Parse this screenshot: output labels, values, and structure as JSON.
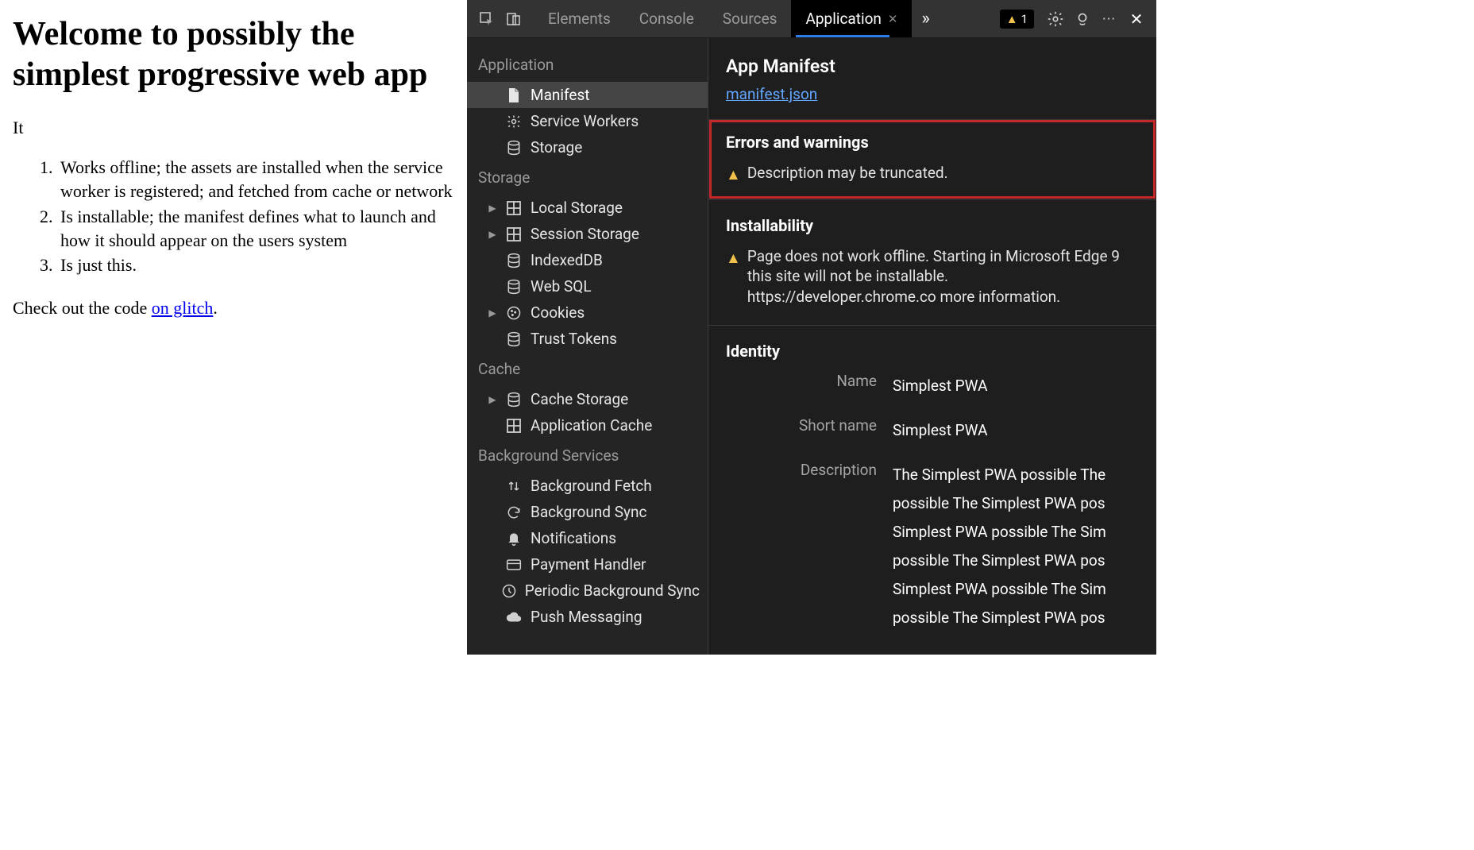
{
  "page": {
    "heading": "Welcome to possibly the simplest progressive web app",
    "intro": "It",
    "list": [
      "Works offline; the assets are installed when the service worker is registered; and fetched from cache or network",
      "Is installable; the manifest defines what to launch and how it should appear on the users system",
      "Is just this."
    ],
    "footer_prefix": "Check out the code ",
    "footer_link": "on glitch",
    "footer_suffix": "."
  },
  "devtools": {
    "tabs": [
      "Elements",
      "Console",
      "Sources",
      "Application"
    ],
    "active_tab": "Application",
    "warning_count": "1",
    "sidebar": {
      "groups": [
        {
          "title": "Application",
          "items": [
            {
              "icon": "file",
              "label": "Manifest",
              "selected": true
            },
            {
              "icon": "gear",
              "label": "Service Workers"
            },
            {
              "icon": "db",
              "label": "Storage"
            }
          ]
        },
        {
          "title": "Storage",
          "items": [
            {
              "icon": "grid",
              "label": "Local Storage",
              "expandable": true
            },
            {
              "icon": "grid",
              "label": "Session Storage",
              "expandable": true
            },
            {
              "icon": "db",
              "label": "IndexedDB"
            },
            {
              "icon": "db",
              "label": "Web SQL"
            },
            {
              "icon": "cookie",
              "label": "Cookies",
              "expandable": true
            },
            {
              "icon": "db",
              "label": "Trust Tokens"
            }
          ]
        },
        {
          "title": "Cache",
          "items": [
            {
              "icon": "db",
              "label": "Cache Storage",
              "expandable": true
            },
            {
              "icon": "grid",
              "label": "Application Cache"
            }
          ]
        },
        {
          "title": "Background Services",
          "items": [
            {
              "icon": "updown",
              "label": "Background Fetch"
            },
            {
              "icon": "sync",
              "label": "Background Sync"
            },
            {
              "icon": "bell",
              "label": "Notifications"
            },
            {
              "icon": "card",
              "label": "Payment Handler"
            },
            {
              "icon": "clock",
              "label": "Periodic Background Sync"
            },
            {
              "icon": "cloud",
              "label": "Push Messaging"
            }
          ]
        }
      ]
    },
    "detail": {
      "title": "App Manifest",
      "manifest_link": "manifest.json",
      "errors_heading": "Errors and warnings",
      "errors_warning": "Description may be truncated.",
      "installability_heading": "Installability",
      "installability_warning": "Page does not work offline. Starting in Microsoft Edge 9 this site will not be installable. https://developer.chrome.co more information.",
      "identity_heading": "Identity",
      "identity": [
        {
          "label": "Name",
          "value": "Simplest PWA"
        },
        {
          "label": "Short name",
          "value": "Simplest PWA"
        },
        {
          "label": "Description",
          "value": "The Simplest PWA possible The possible The Simplest PWA pos Simplest PWA possible The Sim possible The Simplest PWA pos Simplest PWA possible The Sim possible The Simplest PWA pos"
        }
      ]
    }
  }
}
